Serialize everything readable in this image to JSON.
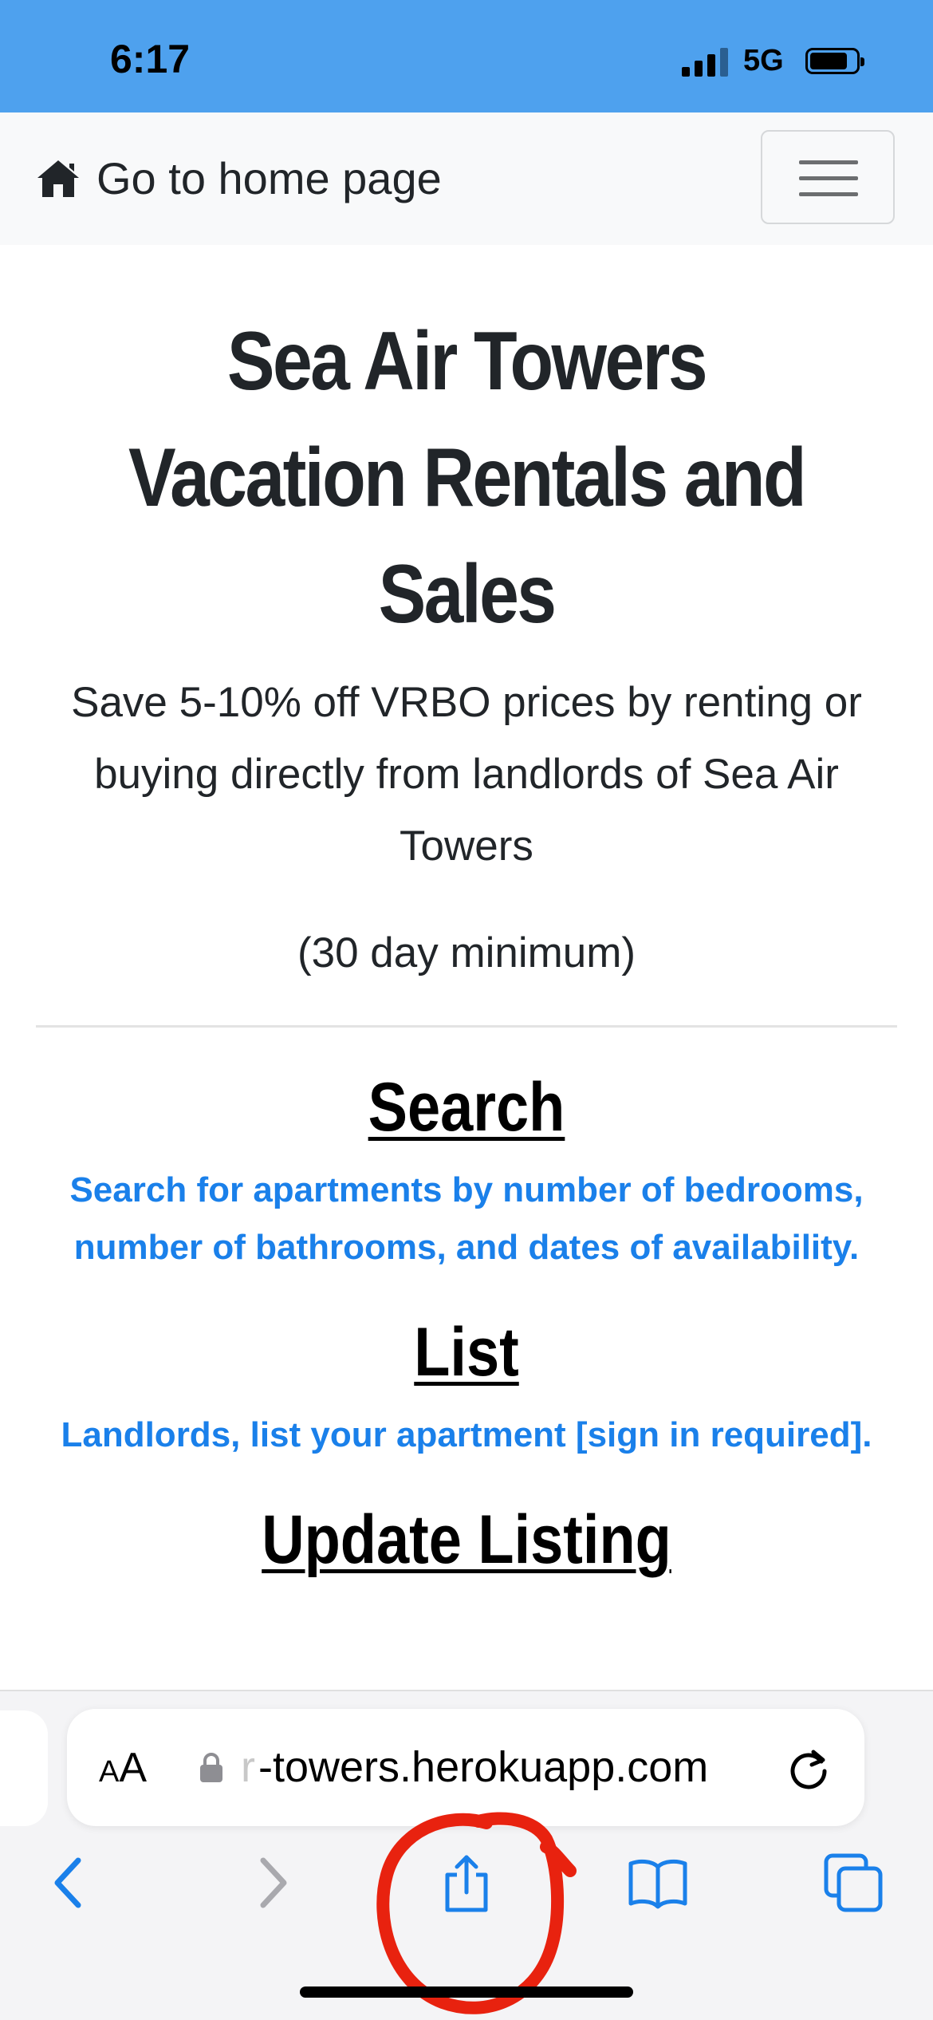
{
  "status_bar": {
    "time": "6:17",
    "network": "5G",
    "background_color": "#4ea1ee"
  },
  "navbar": {
    "home_icon": "house-icon",
    "home_link": "Go to home page",
    "menu_icon": "hamburger-menu-icon"
  },
  "main": {
    "title": "Sea Air Towers Vacation Rentals and Sales",
    "lead": "Save 5-10% off VRBO prices by renting or buying directly from landlords of Sea Air Towers",
    "minimum_note": "(30 day minimum)",
    "sections": [
      {
        "title": "Search",
        "link": "Search for apartments by number of bedrooms, number of bathrooms, and dates of availability."
      },
      {
        "title": "List",
        "link": "Landlords, list your apartment [sign in required]."
      },
      {
        "title": "Update Listing"
      }
    ],
    "link_color": "#1a80ea"
  },
  "safari": {
    "text_size_label": "AA",
    "url_fade": "r",
    "url": "-towers.herokuapp.com",
    "icons": {
      "lock": "lock-icon",
      "reload": "reload-icon",
      "back": "back-chevron-icon",
      "forward": "forward-chevron-icon",
      "share": "share-icon",
      "bookmarks": "bookmarks-book-icon",
      "tabs": "tabs-icon"
    },
    "accent_color": "#1a80ea"
  },
  "annotation": {
    "color": "#e8220f",
    "shape": "hand-drawn circle around share button"
  }
}
